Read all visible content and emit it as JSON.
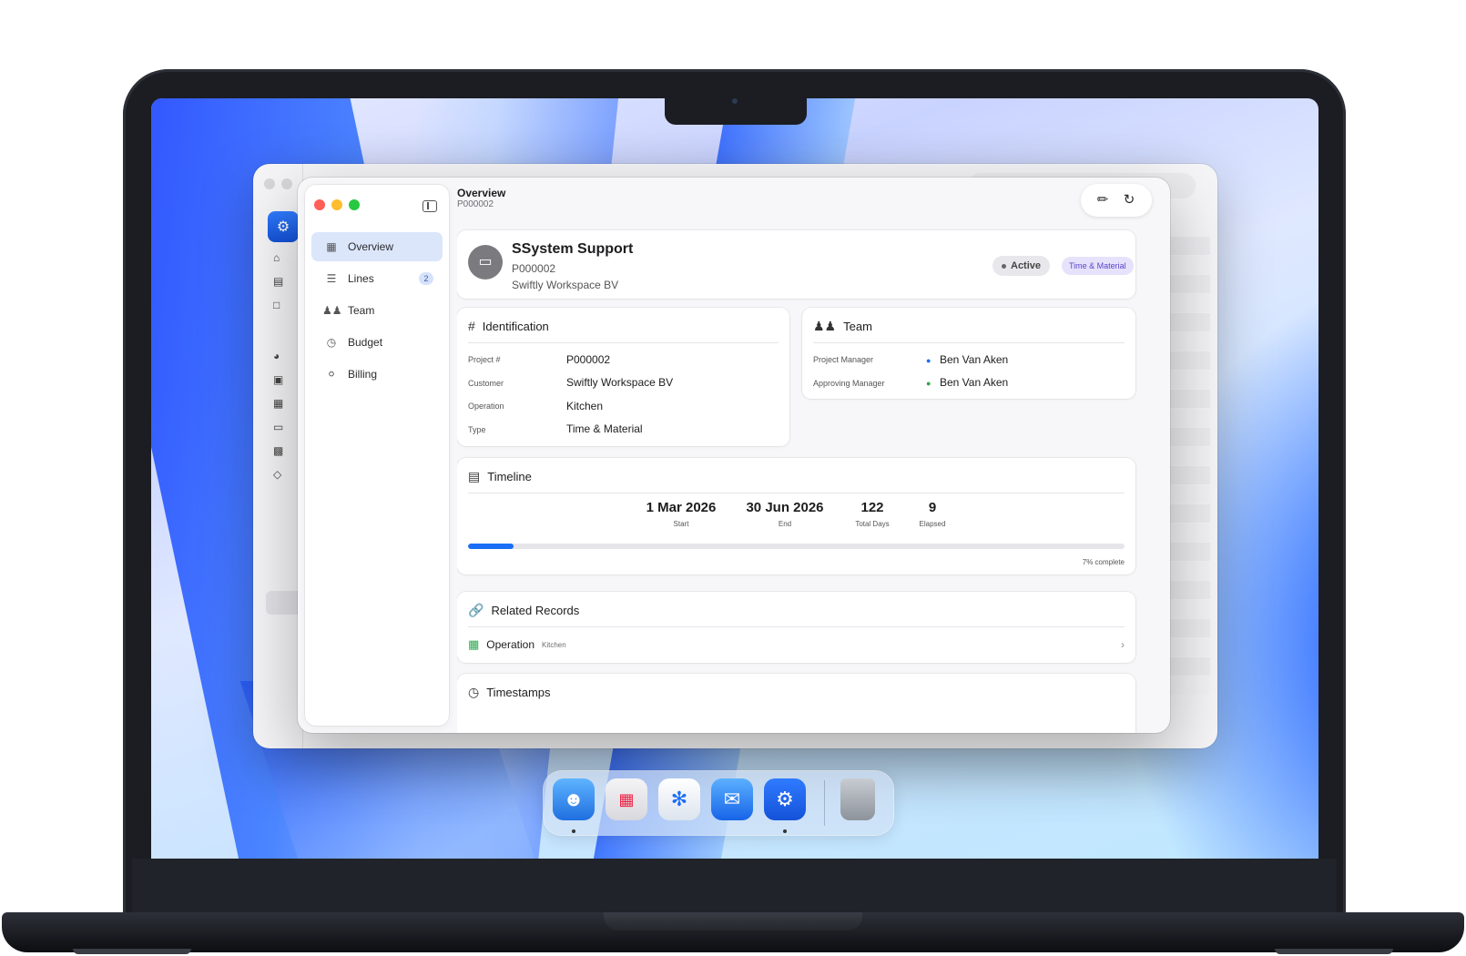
{
  "window": {
    "header_title": "Overview",
    "header_subtitle": "P000002"
  },
  "sidebar": {
    "items": [
      {
        "label": "Overview",
        "icon": "grid-icon",
        "active": true
      },
      {
        "label": "Lines",
        "icon": "list-icon",
        "badge": "2"
      },
      {
        "label": "Team",
        "icon": "people-icon"
      },
      {
        "label": "Budget",
        "icon": "gauge-icon"
      },
      {
        "label": "Billing",
        "icon": "dollar-circle-icon"
      }
    ]
  },
  "project": {
    "name": "SSystem Support",
    "number": "P000002",
    "customer": "Swiftly Workspace BV",
    "status": "Active",
    "type_badge": "Time & Material"
  },
  "identification": {
    "title": "Identification",
    "rows": [
      {
        "label": "Project #",
        "value": "P000002"
      },
      {
        "label": "Customer",
        "value": "Swiftly Workspace BV"
      },
      {
        "label": "Operation",
        "value": "Kitchen"
      },
      {
        "label": "Type",
        "value": "Time & Material"
      }
    ]
  },
  "team": {
    "title": "Team",
    "rows": [
      {
        "label": "Project Manager",
        "value": "Ben Van Aken"
      },
      {
        "label": "Approving Manager",
        "value": "Ben Van Aken"
      }
    ]
  },
  "timeline": {
    "title": "Timeline",
    "start": "1 Mar 2026",
    "start_caption": "Start",
    "end": "30 Jun 2026",
    "end_caption": "End",
    "total_days": "122",
    "total_days_caption": "Total Days",
    "elapsed": "9",
    "elapsed_caption": "Elapsed",
    "progress_percent": 7,
    "progress_caption": "7% complete"
  },
  "related": {
    "title": "Related Records",
    "items": [
      {
        "label": "Operation",
        "sub": "Kitchen"
      }
    ]
  },
  "timestamps": {
    "title": "Timestamps"
  },
  "colors": {
    "accent": "#1a6ef5",
    "active_nav": "#dbe6fb",
    "type_badge_bg": "#e7e2fb",
    "type_badge_text": "#5a45c8"
  },
  "dock": {
    "apps": [
      "finder-icon",
      "launchpad-icon",
      "safari-icon",
      "mail-icon",
      "app-icon",
      "trash-icon"
    ]
  }
}
